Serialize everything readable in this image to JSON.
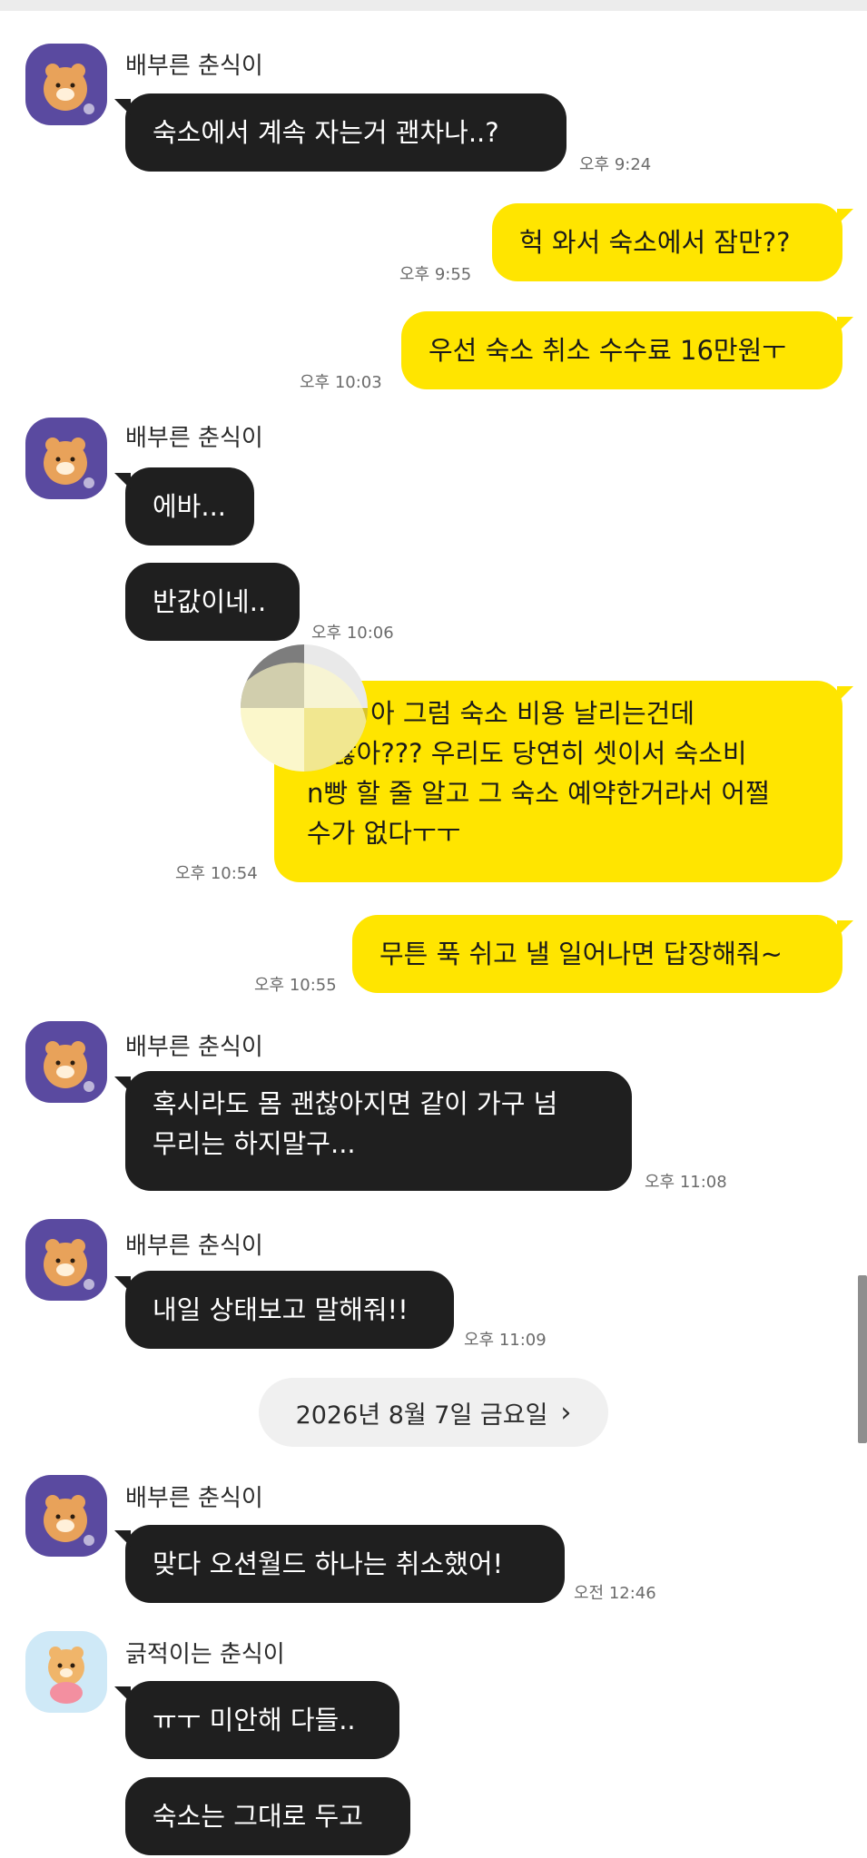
{
  "messages": [
    {
      "sender": "배부른 춘식이",
      "text": "숙소에서 계속 자는거 괜차나..?",
      "time": "오후 9:24"
    },
    {
      "text": "헉 와서 숙소에서 잠만??",
      "time": "오후 9:55"
    },
    {
      "text": "우선 숙소 취소 수수료 16만원ㅜ",
      "time": "오후 10:03"
    },
    {
      "sender": "배부른 춘식이",
      "text": "에바..."
    },
    {
      "text": "반값이네..",
      "time": "오후 10:06"
    },
    {
      "lines": [
        "아 그럼 숙소 비용 날리는건데",
        "잖아??? 우리도 당연히 셋이서 숙소비",
        "n빵 할 줄 알고 그 숙소 예약한거라서 어쩔",
        "수가 없다ㅜㅜ"
      ],
      "time": "오후 10:54"
    },
    {
      "text": "무튼 푹 쉬고 낼 일어나면 답장해줘~",
      "time": "오후 10:55"
    },
    {
      "sender": "배부른 춘식이",
      "lines": [
        "혹시라도 몸 괜찮아지면 같이 가구 넘",
        "무리는 하지말구..."
      ],
      "time": "오후 11:08"
    },
    {
      "sender": "배부른 춘식이",
      "text": "내일 상태보고 말해줘!!",
      "time": "오후 11:09"
    },
    {
      "sender": "배부른 춘식이",
      "text": "맞다 오션월드 하나는 취소했어!",
      "time": "오전 12:46"
    },
    {
      "sender": "긁적이는 춘식이",
      "text": "ㅠㅜ 미안해 다들.."
    },
    {
      "text": "숙소는 그대로 두고"
    }
  ],
  "date_divider": {
    "label": "2026년 8월 7일 금요일",
    "chevron": "›"
  },
  "icons": {
    "avatar": "choonsik-avatar-icon",
    "chevron": "chevron-right-icon"
  },
  "colors": {
    "outgoing_bubble": "#ffe500",
    "incoming_bubble": "#1f1f1f",
    "avatar_bg": "#5a4aa0",
    "avatar_bg_alt": "#cfe9f7"
  }
}
